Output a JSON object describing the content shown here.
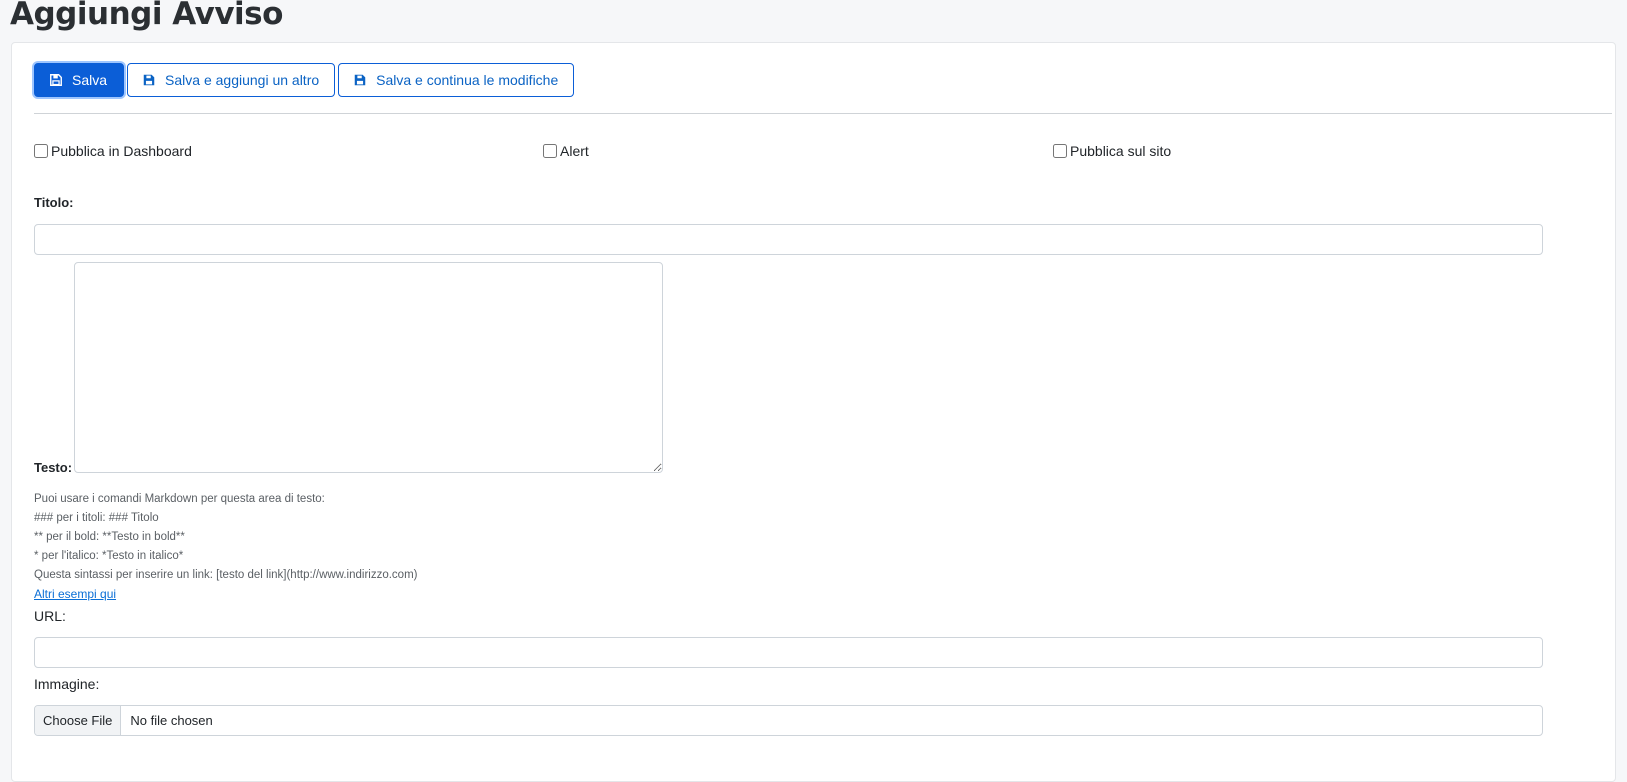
{
  "page": {
    "title": "Aggiungi Avviso"
  },
  "toolbar": {
    "save": {
      "label": "Salva",
      "icon": "floppy-disk-icon"
    },
    "save_add": {
      "label": "Salva e aggiungi un altro",
      "icon": "floppy-disk-icon"
    },
    "save_continue": {
      "label": "Salva e continua le modifiche",
      "icon": "floppy-disk-icon"
    }
  },
  "options": {
    "dashboard": {
      "label": "Pubblica in Dashboard",
      "checked": false
    },
    "alert": {
      "label": "Alert",
      "checked": false
    },
    "site": {
      "label": "Pubblica sul sito",
      "checked": false
    }
  },
  "form": {
    "titolo": {
      "label": "Titolo:",
      "value": ""
    },
    "testo": {
      "label": "Testo:",
      "value": "",
      "help": [
        "Puoi usare i comandi Markdown per questa area di testo:",
        "### per i titoli: ### Titolo",
        "** per il bold: **Testo in bold**",
        "* per l'italico: *Testo in italico*",
        "Questa sintassi per inserire un link: [testo del link](http://www.indirizzo.com)"
      ],
      "help_link": "Altri esempi qui"
    },
    "url": {
      "label": "URL:",
      "value": ""
    },
    "immagine": {
      "label": "Immagine:",
      "button": "Choose File",
      "status": "No file chosen"
    }
  },
  "colors": {
    "primary": "#0b5ed7",
    "link": "#0b6fd6",
    "border": "#ced4da"
  }
}
